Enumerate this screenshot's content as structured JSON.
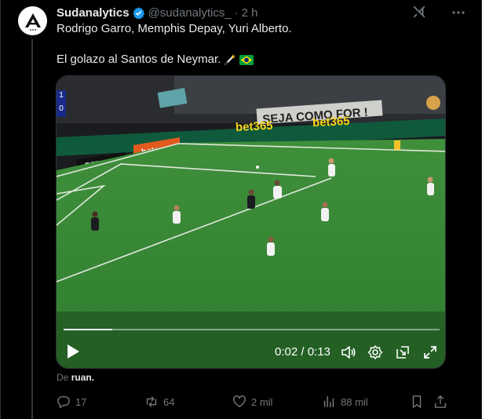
{
  "author": {
    "name": "Sudanalytics",
    "handle": "@sudanalytics_",
    "separator": "·",
    "time": "2 h"
  },
  "tweet": {
    "line1": "Rodrigo Garro, Memphis Depay, Yuri Alberto.",
    "line2": "El golazo al Santos de Neymar."
  },
  "video": {
    "scoreboard_home": "1",
    "scoreboard_away": "0",
    "board_text_1": "bet365",
    "board_text_2": "bet365",
    "board_text_3": "betano",
    "board_text_4": "BETER",
    "banner_text": "SEJA COMO FOR !",
    "timecode": "0:02 / 0:13",
    "progress": 0.13
  },
  "attribution": {
    "prefix": "De",
    "user": "ruan."
  },
  "actions": {
    "replies": "17",
    "reposts": "64",
    "likes": "2 mil",
    "views": "88 mil"
  },
  "colors": {
    "background": "#000000",
    "text": "#e7e9ea",
    "muted": "#71767b",
    "verified": "#1d9bf0",
    "pitch": "#3e8e3a"
  },
  "icons": {
    "verified": "verified-badge-icon",
    "grok": "grok-icon",
    "more": "more-icon",
    "play": "play-icon",
    "volume": "volume-icon",
    "settings": "settings-icon",
    "pip": "pip-icon",
    "fullscreen": "fullscreen-icon",
    "reply": "reply-icon",
    "repost": "repost-icon",
    "like": "like-icon",
    "views": "views-icon",
    "bookmark": "bookmark-icon",
    "share": "share-icon"
  }
}
